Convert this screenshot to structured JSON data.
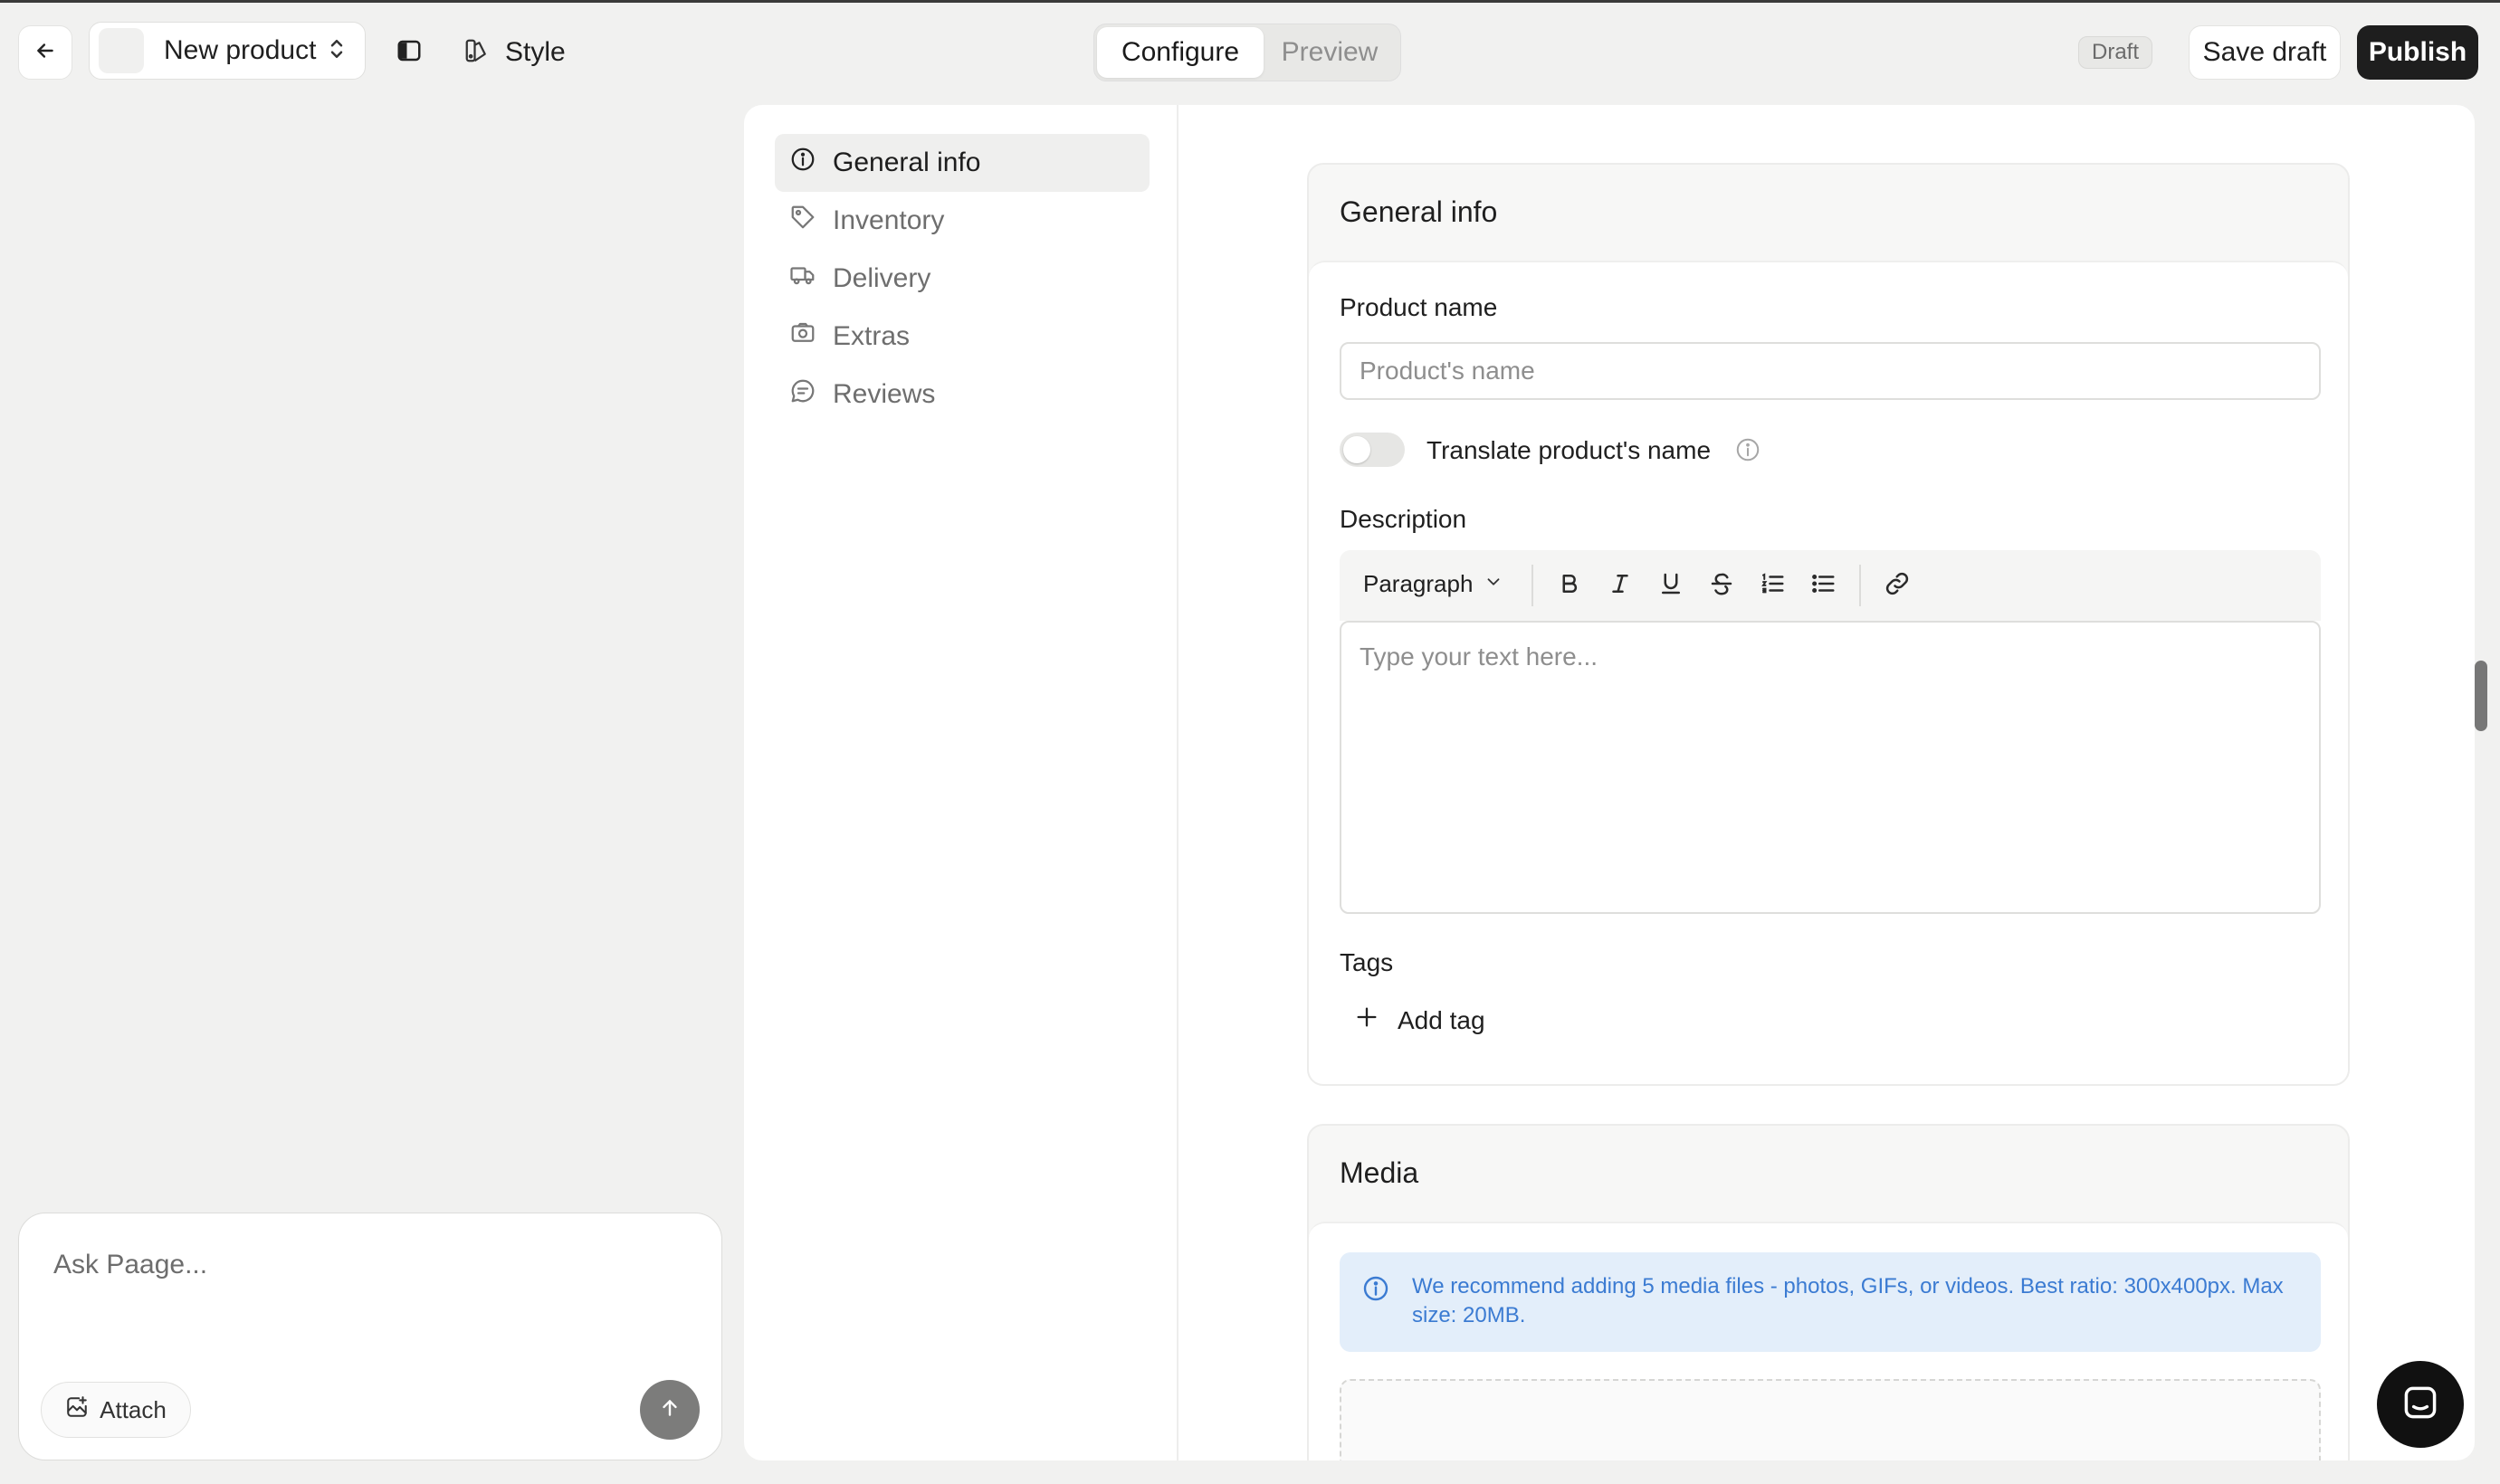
{
  "header": {
    "product_switch_label": "New product",
    "style_label": "Style",
    "tabs": [
      {
        "label": "Configure",
        "active": true
      },
      {
        "label": "Preview",
        "active": false
      }
    ],
    "status_badge": "Draft",
    "save_draft_label": "Save draft",
    "publish_label": "Publish"
  },
  "chat": {
    "placeholder": "Ask Paage...",
    "attach_label": "Attach"
  },
  "sections_nav": {
    "items": [
      {
        "label": "General info",
        "icon": "info-icon",
        "active": true
      },
      {
        "label": "Inventory",
        "icon": "tag-icon",
        "active": false
      },
      {
        "label": "Delivery",
        "icon": "truck-icon",
        "active": false
      },
      {
        "label": "Extras",
        "icon": "camera-icon",
        "active": false
      },
      {
        "label": "Reviews",
        "icon": "chat-bubble-icon",
        "active": false
      }
    ]
  },
  "general_info": {
    "title": "General info",
    "product_name_label": "Product name",
    "product_name_placeholder": "Product's name",
    "product_name_value": "",
    "translate_label": "Translate product's name",
    "translate_enabled": false,
    "description_label": "Description",
    "paragraph_select": "Paragraph",
    "toolbar_icons": [
      "bold-icon",
      "italic-icon",
      "underline-icon",
      "strikethrough-icon",
      "ordered-list-icon",
      "bullet-list-icon",
      "link-icon"
    ],
    "description_placeholder": "Type your text here...",
    "tags_label": "Tags",
    "add_tag_label": "Add tag"
  },
  "media": {
    "title": "Media",
    "alert_text": "We recommend adding 5 media files - photos, GIFs, or videos. Best ratio: 300x400px. Max size: 20MB."
  },
  "colors": {
    "publish_bg": "#1e1e1e",
    "alert_bg": "#e3eefa",
    "alert_text": "#3b7bd2",
    "page_bg": "#f1f1f0"
  }
}
